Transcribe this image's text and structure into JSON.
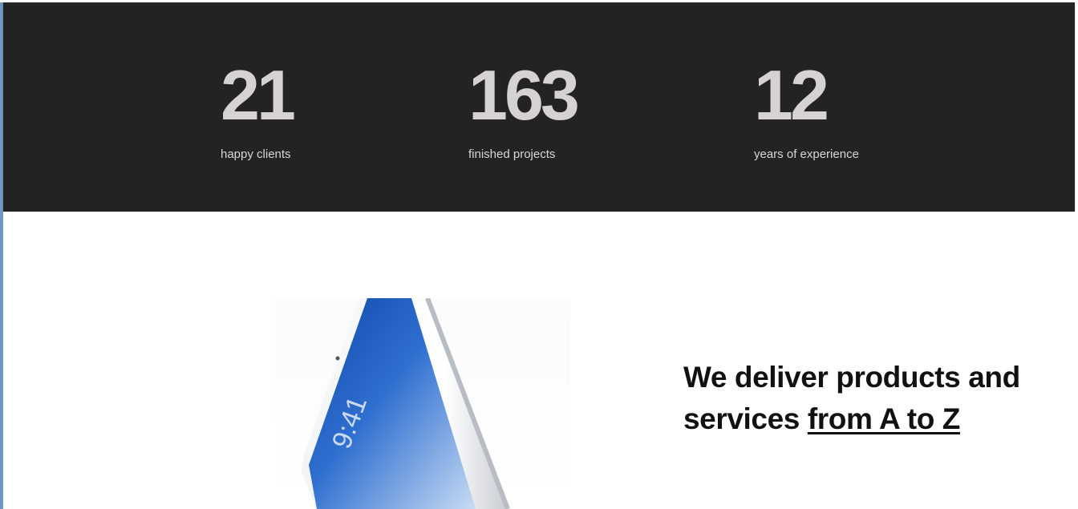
{
  "stats": {
    "items": [
      {
        "number": "21",
        "label": "happy clients"
      },
      {
        "number": "163",
        "label": "finished projects"
      },
      {
        "number": "12",
        "label": "years of experience"
      }
    ]
  },
  "intro": {
    "headline_part1": "We deliver products and services ",
    "headline_link": "from A to Z",
    "device_time": "9:41"
  },
  "colors": {
    "stats_background": "#232323",
    "stat_text": "#d6d2d2",
    "headline_text": "#111111",
    "screen_blue": "#2f6fd0"
  }
}
